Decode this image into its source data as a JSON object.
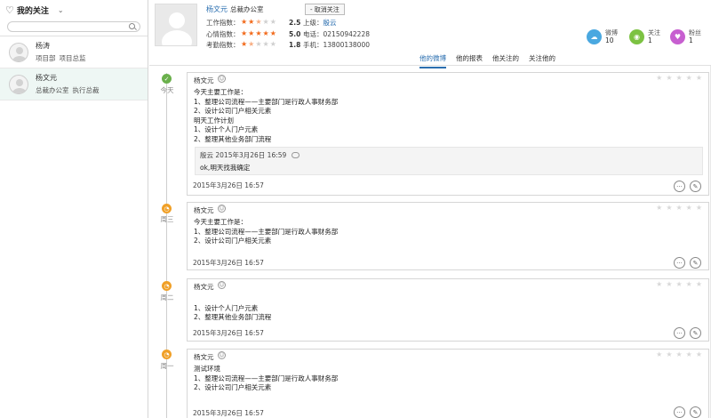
{
  "sidebar": {
    "title": "我的关注",
    "search_placeholder": "",
    "contacts": [
      {
        "name": "杨涛",
        "dept": "项目部",
        "role": "项目总监"
      },
      {
        "name": "杨文元",
        "dept": "总裁办公室",
        "role": "执行总裁"
      }
    ]
  },
  "profile": {
    "name": "杨文元",
    "dept": "总裁办公室",
    "unfollow_label": "- 取消关注",
    "ratings": [
      {
        "label": "工作指数：",
        "score": "2.5",
        "value": 2.5,
        "info_label": "上级：",
        "info_value": "殷云"
      },
      {
        "label": "心情指数：",
        "score": "5.0",
        "value": 5.0,
        "info_label": "电话：",
        "info_value": "02150942228"
      },
      {
        "label": "考勤指数：",
        "score": "1.8",
        "value": 1.8,
        "info_label": "手机：",
        "info_value": "13800138000"
      }
    ],
    "stats": [
      {
        "label": "微博",
        "value": "10",
        "color": "#4aa8e0",
        "icon": "weibo-icon"
      },
      {
        "label": "关注",
        "value": "1",
        "color": "#7cc242",
        "icon": "eye-icon"
      },
      {
        "label": "粉丝",
        "value": "1",
        "color": "#c75fd0",
        "icon": "fans-icon"
      }
    ]
  },
  "tabs": [
    "他的微博",
    "他的报表",
    "他关注的",
    "关注他的"
  ],
  "timeline": [
    {
      "day": "今天",
      "author": "杨文元",
      "lines": [
        "今天主要工作是：",
        "1、整理公司流程——主要部门是行政人事财务部",
        "2、设计公司门户相关元素",
        "明天工作计划",
        "1、设计个人门户元素",
        "2、整理其他业务部门流程"
      ],
      "comment": {
        "author": "殷云",
        "time": "2015年3月26日 16:59",
        "text": "ok,明天找我确定"
      },
      "time": "2015年3月26日 16:57"
    },
    {
      "day": "周三",
      "author": "杨文元",
      "lines": [
        "今天主要工作是：",
        "1、整理公司流程——主要部门是行政人事财务部",
        "2、设计公司门户相关元素"
      ],
      "time": "2015年3月26日 16:57"
    },
    {
      "day": "周二",
      "author": "杨文元",
      "lines": [
        "",
        "1、设计个人门户元素",
        "2、整理其他业务部门流程"
      ],
      "time": "2015年3月26日 16:57"
    },
    {
      "day": "周一",
      "author": "杨文元",
      "lines": [
        "测试环境",
        "1、整理公司流程——主要部门是行政人事财务部",
        "2、设计公司门户相关元素"
      ],
      "time": "2015年3月26日 16:57"
    }
  ]
}
